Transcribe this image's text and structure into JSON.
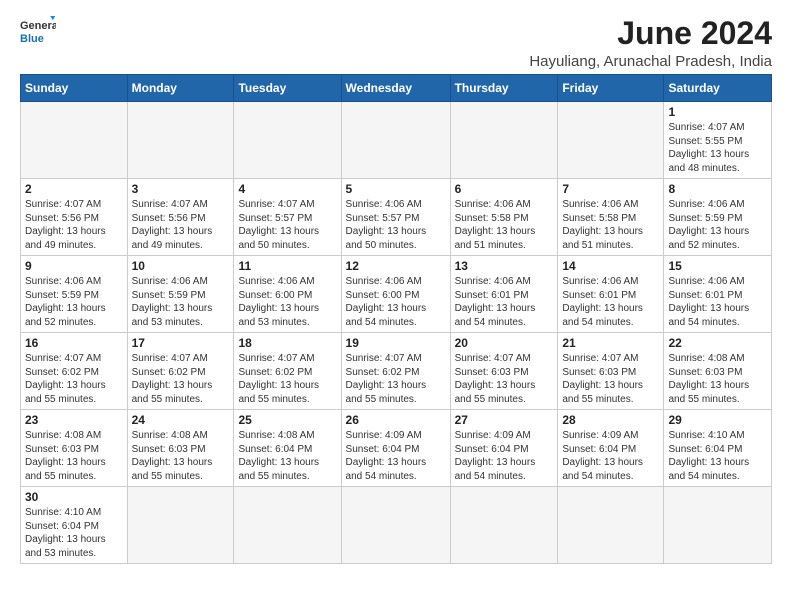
{
  "header": {
    "logo_general": "General",
    "logo_blue": "Blue",
    "month_year": "June 2024",
    "location": "Hayuliang, Arunachal Pradesh, India"
  },
  "days_of_week": [
    "Sunday",
    "Monday",
    "Tuesday",
    "Wednesday",
    "Thursday",
    "Friday",
    "Saturday"
  ],
  "weeks": [
    [
      {
        "day": "",
        "info": ""
      },
      {
        "day": "",
        "info": ""
      },
      {
        "day": "",
        "info": ""
      },
      {
        "day": "",
        "info": ""
      },
      {
        "day": "",
        "info": ""
      },
      {
        "day": "",
        "info": ""
      },
      {
        "day": "1",
        "info": "Sunrise: 4:07 AM\nSunset: 5:55 PM\nDaylight: 13 hours\nand 48 minutes."
      }
    ],
    [
      {
        "day": "2",
        "info": "Sunrise: 4:07 AM\nSunset: 5:56 PM\nDaylight: 13 hours\nand 49 minutes."
      },
      {
        "day": "3",
        "info": "Sunrise: 4:07 AM\nSunset: 5:56 PM\nDaylight: 13 hours\nand 49 minutes."
      },
      {
        "day": "4",
        "info": "Sunrise: 4:07 AM\nSunset: 5:57 PM\nDaylight: 13 hours\nand 50 minutes."
      },
      {
        "day": "5",
        "info": "Sunrise: 4:06 AM\nSunset: 5:57 PM\nDaylight: 13 hours\nand 50 minutes."
      },
      {
        "day": "6",
        "info": "Sunrise: 4:06 AM\nSunset: 5:58 PM\nDaylight: 13 hours\nand 51 minutes."
      },
      {
        "day": "7",
        "info": "Sunrise: 4:06 AM\nSunset: 5:58 PM\nDaylight: 13 hours\nand 51 minutes."
      },
      {
        "day": "8",
        "info": "Sunrise: 4:06 AM\nSunset: 5:59 PM\nDaylight: 13 hours\nand 52 minutes."
      }
    ],
    [
      {
        "day": "9",
        "info": "Sunrise: 4:06 AM\nSunset: 5:59 PM\nDaylight: 13 hours\nand 52 minutes."
      },
      {
        "day": "10",
        "info": "Sunrise: 4:06 AM\nSunset: 5:59 PM\nDaylight: 13 hours\nand 53 minutes."
      },
      {
        "day": "11",
        "info": "Sunrise: 4:06 AM\nSunset: 6:00 PM\nDaylight: 13 hours\nand 53 minutes."
      },
      {
        "day": "12",
        "info": "Sunrise: 4:06 AM\nSunset: 6:00 PM\nDaylight: 13 hours\nand 54 minutes."
      },
      {
        "day": "13",
        "info": "Sunrise: 4:06 AM\nSunset: 6:01 PM\nDaylight: 13 hours\nand 54 minutes."
      },
      {
        "day": "14",
        "info": "Sunrise: 4:06 AM\nSunset: 6:01 PM\nDaylight: 13 hours\nand 54 minutes."
      },
      {
        "day": "15",
        "info": "Sunrise: 4:06 AM\nSunset: 6:01 PM\nDaylight: 13 hours\nand 54 minutes."
      }
    ],
    [
      {
        "day": "16",
        "info": "Sunrise: 4:07 AM\nSunset: 6:02 PM\nDaylight: 13 hours\nand 55 minutes."
      },
      {
        "day": "17",
        "info": "Sunrise: 4:07 AM\nSunset: 6:02 PM\nDaylight: 13 hours\nand 55 minutes."
      },
      {
        "day": "18",
        "info": "Sunrise: 4:07 AM\nSunset: 6:02 PM\nDaylight: 13 hours\nand 55 minutes."
      },
      {
        "day": "19",
        "info": "Sunrise: 4:07 AM\nSunset: 6:02 PM\nDaylight: 13 hours\nand 55 minutes."
      },
      {
        "day": "20",
        "info": "Sunrise: 4:07 AM\nSunset: 6:03 PM\nDaylight: 13 hours\nand 55 minutes."
      },
      {
        "day": "21",
        "info": "Sunrise: 4:07 AM\nSunset: 6:03 PM\nDaylight: 13 hours\nand 55 minutes."
      },
      {
        "day": "22",
        "info": "Sunrise: 4:08 AM\nSunset: 6:03 PM\nDaylight: 13 hours\nand 55 minutes."
      }
    ],
    [
      {
        "day": "23",
        "info": "Sunrise: 4:08 AM\nSunset: 6:03 PM\nDaylight: 13 hours\nand 55 minutes."
      },
      {
        "day": "24",
        "info": "Sunrise: 4:08 AM\nSunset: 6:03 PM\nDaylight: 13 hours\nand 55 minutes."
      },
      {
        "day": "25",
        "info": "Sunrise: 4:08 AM\nSunset: 6:04 PM\nDaylight: 13 hours\nand 55 minutes."
      },
      {
        "day": "26",
        "info": "Sunrise: 4:09 AM\nSunset: 6:04 PM\nDaylight: 13 hours\nand 54 minutes."
      },
      {
        "day": "27",
        "info": "Sunrise: 4:09 AM\nSunset: 6:04 PM\nDaylight: 13 hours\nand 54 minutes."
      },
      {
        "day": "28",
        "info": "Sunrise: 4:09 AM\nSunset: 6:04 PM\nDaylight: 13 hours\nand 54 minutes."
      },
      {
        "day": "29",
        "info": "Sunrise: 4:10 AM\nSunset: 6:04 PM\nDaylight: 13 hours\nand 54 minutes."
      }
    ],
    [
      {
        "day": "30",
        "info": "Sunrise: 4:10 AM\nSunset: 6:04 PM\nDaylight: 13 hours\nand 53 minutes."
      },
      {
        "day": "",
        "info": ""
      },
      {
        "day": "",
        "info": ""
      },
      {
        "day": "",
        "info": ""
      },
      {
        "day": "",
        "info": ""
      },
      {
        "day": "",
        "info": ""
      },
      {
        "day": "",
        "info": ""
      }
    ]
  ]
}
